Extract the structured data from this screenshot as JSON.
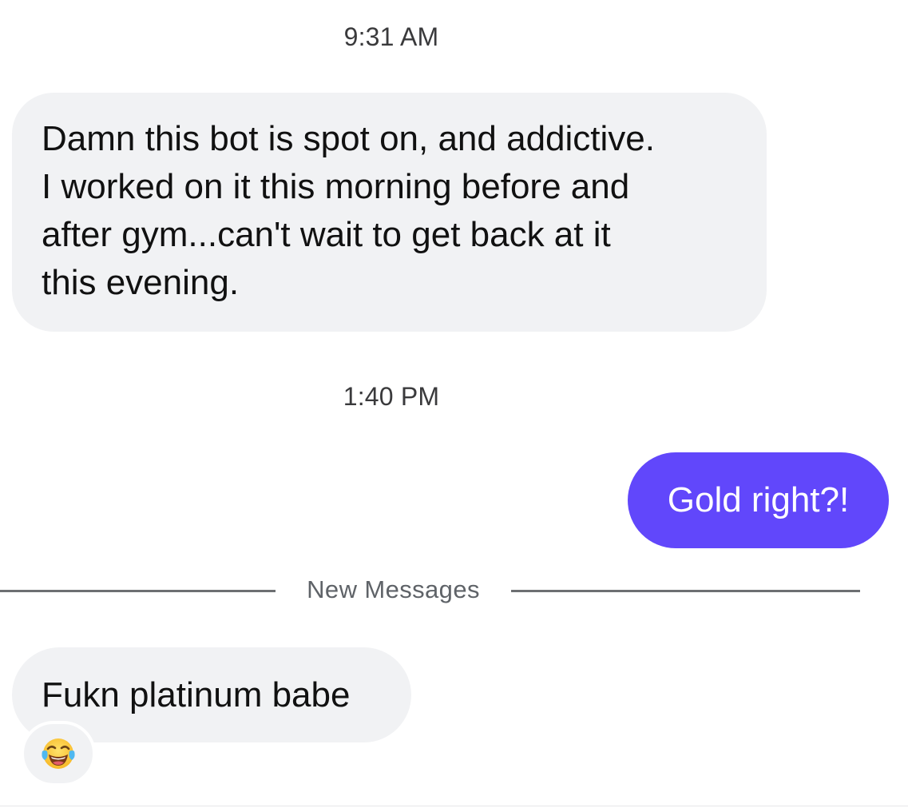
{
  "conversation": {
    "timestamps": [
      "9:31 AM",
      "1:40 PM"
    ],
    "messages": [
      {
        "direction": "incoming",
        "text": "Damn this bot is spot on, and addictive.\nI worked on it this morning before and\nafter gym...can't wait to get back at it\nthis evening."
      },
      {
        "direction": "outgoing",
        "text": "Gold right?!"
      },
      {
        "direction": "incoming",
        "text": "Fukn platinum babe",
        "reaction": "face-with-tears-of-joy"
      }
    ],
    "divider_label": "New Messages"
  },
  "colors": {
    "incoming_bubble": "#f1f2f4",
    "outgoing_bubble": "#6147fb",
    "divider": "#6d6f72"
  }
}
